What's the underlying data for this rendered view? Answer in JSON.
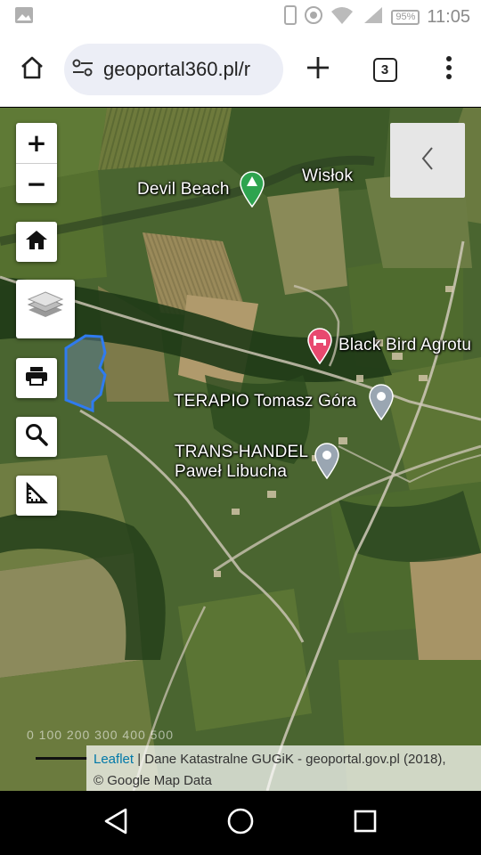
{
  "status_bar": {
    "time": "11:05",
    "battery": "95%",
    "icons": [
      "gallery-icon",
      "phone-icon",
      "data-saver-icon",
      "wifi-icon",
      "signal-icon"
    ]
  },
  "browser": {
    "url": "geoportal360.pl/r",
    "tab_count": "3",
    "icons": [
      "home-icon",
      "site-settings-icon",
      "new-tab-plus-icon",
      "tab-switcher-icon",
      "more-vert-icon"
    ]
  },
  "map": {
    "zoom_in_label": "+",
    "zoom_out_label": "−",
    "controls": [
      "home-icon",
      "layers-icon",
      "print-icon",
      "search-icon",
      "measure-ruler-icon"
    ],
    "collapse_icon": "chevron-left-icon",
    "labels": {
      "river": "Wisłok",
      "devil_beach": "Devil Beach",
      "black_bird": "Black Bird Agrotu",
      "terapio": "TERAPIO Tomasz Góra",
      "trans_handel_1": "TRANS-HANDEL",
      "trans_handel_2": "Paweł Libucha"
    },
    "scale_ticks": "0  100  200  300  400  500",
    "attribution": {
      "leaflet": "Leaflet",
      "text": " | Dane Katastralne GUGiK - geoportal.gov.pl (2018),",
      "line2": "© Google Map Data"
    },
    "colors": {
      "parcel_outline": "#2f7bf0",
      "park_pin": "#2ea44f",
      "hotel_pin": "#e8496f",
      "place_pin": "#9aa6b2"
    }
  },
  "nav_bar": {
    "icons": [
      "back-triangle-icon",
      "home-circle-icon",
      "recents-square-icon"
    ]
  }
}
